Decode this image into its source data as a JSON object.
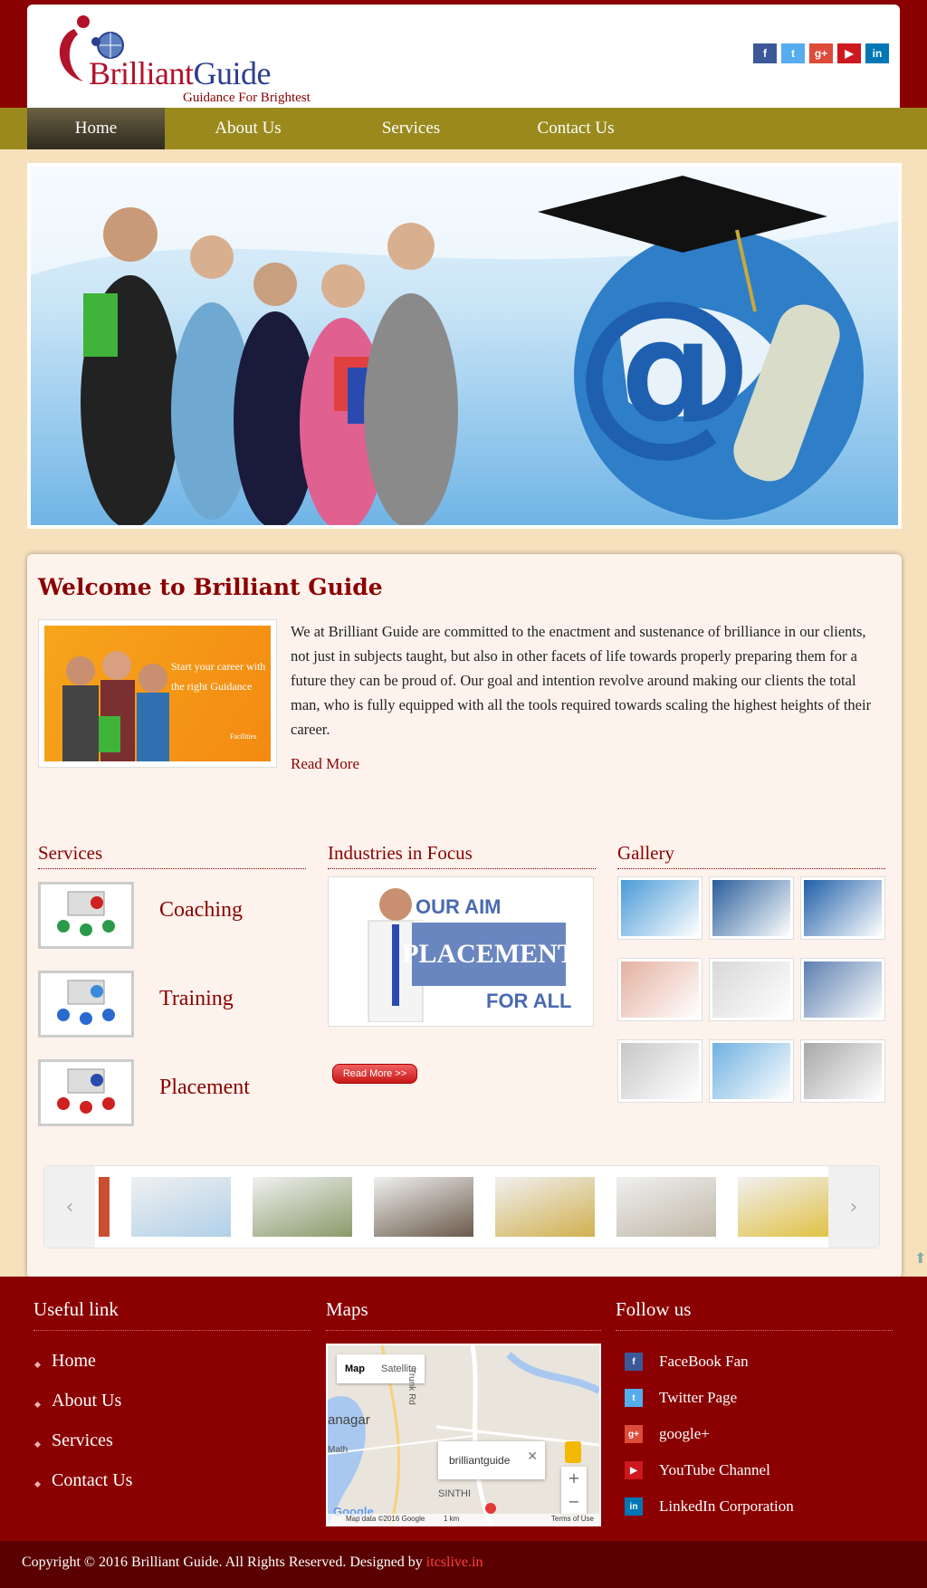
{
  "brand": {
    "name_part1": "Brilliant",
    "name_part2": "Guide",
    "tagline": "Guidance For Brightest Future..."
  },
  "social_top": [
    {
      "icon": "facebook-icon",
      "glyph": "f",
      "color": "#3b5998"
    },
    {
      "icon": "twitter-icon",
      "glyph": "t",
      "color": "#55acee"
    },
    {
      "icon": "google-plus-icon",
      "glyph": "g+",
      "color": "#dd4b39"
    },
    {
      "icon": "youtube-icon",
      "glyph": "▶",
      "color": "#cc181e"
    },
    {
      "icon": "linkedin-icon",
      "glyph": "in",
      "color": "#0077b5"
    }
  ],
  "nav": {
    "items": [
      {
        "label": "Home",
        "active": true
      },
      {
        "label": "About Us",
        "active": false
      },
      {
        "label": "Services",
        "active": false
      },
      {
        "label": "Contact Us",
        "active": false
      }
    ]
  },
  "welcome": {
    "title": "Welcome to Brilliant Guide",
    "image_caption_line1": "Start your career with",
    "image_caption_line2": "the right Guidance",
    "image_footer": "Facilities",
    "body": "We at Brilliant Guide are committed to the enactment and sustenance of brilliance in our clients, not just in subjects taught, but also in other facets of life towards properly preparing them for a future they can be proud of. Our goal and intention revolve around making our clients the total man, who is fully equipped with all the tools required towards scaling the highest heights of their career.",
    "read_more": "Read More"
  },
  "services": {
    "title": "Services",
    "items": [
      {
        "label": "Coaching"
      },
      {
        "label": "Training"
      },
      {
        "label": "Placement"
      }
    ]
  },
  "industries": {
    "title": "Industries in Focus",
    "image_line1": "OUR AIM",
    "image_line2": "PLACEMENT",
    "image_line3": "FOR ALL",
    "button": "Read More >>"
  },
  "gallery": {
    "title": "Gallery",
    "colors": [
      "#4a9ad8",
      "#2a5d9a",
      "#1f5fa8",
      "#e4b0a0",
      "#d8d8d8",
      "#5c7fb0",
      "#c8c8c8",
      "#6fb1e0",
      "#a8a8a8"
    ]
  },
  "carousel": {
    "prev_glyph": "‹",
    "next_glyph": "›",
    "colors": [
      "#b0d0e8",
      "#8a9a6a",
      "#6a5a4a",
      "#d0b050",
      "#c0b8a8",
      "#e0c040"
    ]
  },
  "footer": {
    "useful_title": "Useful link",
    "links": [
      "Home",
      "About Us",
      "Services",
      "Contact Us"
    ],
    "maps_title": "Maps",
    "map": {
      "tab_map": "Map",
      "tab_satellite": "Satellite",
      "place": "brilliantguide",
      "label_nagar": "anagar",
      "label_road": "Trunk Rd",
      "label_math": "Math",
      "label_sinthi": "SINTHI",
      "attribution": "Map data ©2016 Google",
      "scale": "1 km",
      "terms": "Terms of Use",
      "google": "Google"
    },
    "follow_title": "Follow us",
    "follow": [
      {
        "label": "FaceBook Fan",
        "icon": "facebook-icon",
        "glyph": "f",
        "color": "#3b5998"
      },
      {
        "label": "Twitter Page",
        "icon": "twitter-icon",
        "glyph": "t",
        "color": "#55acee"
      },
      {
        "label": "google+",
        "icon": "google-plus-icon",
        "glyph": "g+",
        "color": "#dd4b39"
      },
      {
        "label": "YouTube Channel",
        "icon": "youtube-icon",
        "glyph": "▶",
        "color": "#cc181e"
      },
      {
        "label": "LinkedIn Corporation",
        "icon": "linkedin-icon",
        "glyph": "in",
        "color": "#0077b5"
      }
    ]
  },
  "copyright": {
    "text": "Copyright © 2016 Brilliant Guide. All Rights Reserved. Designed by ",
    "link": "itcslive.in"
  }
}
